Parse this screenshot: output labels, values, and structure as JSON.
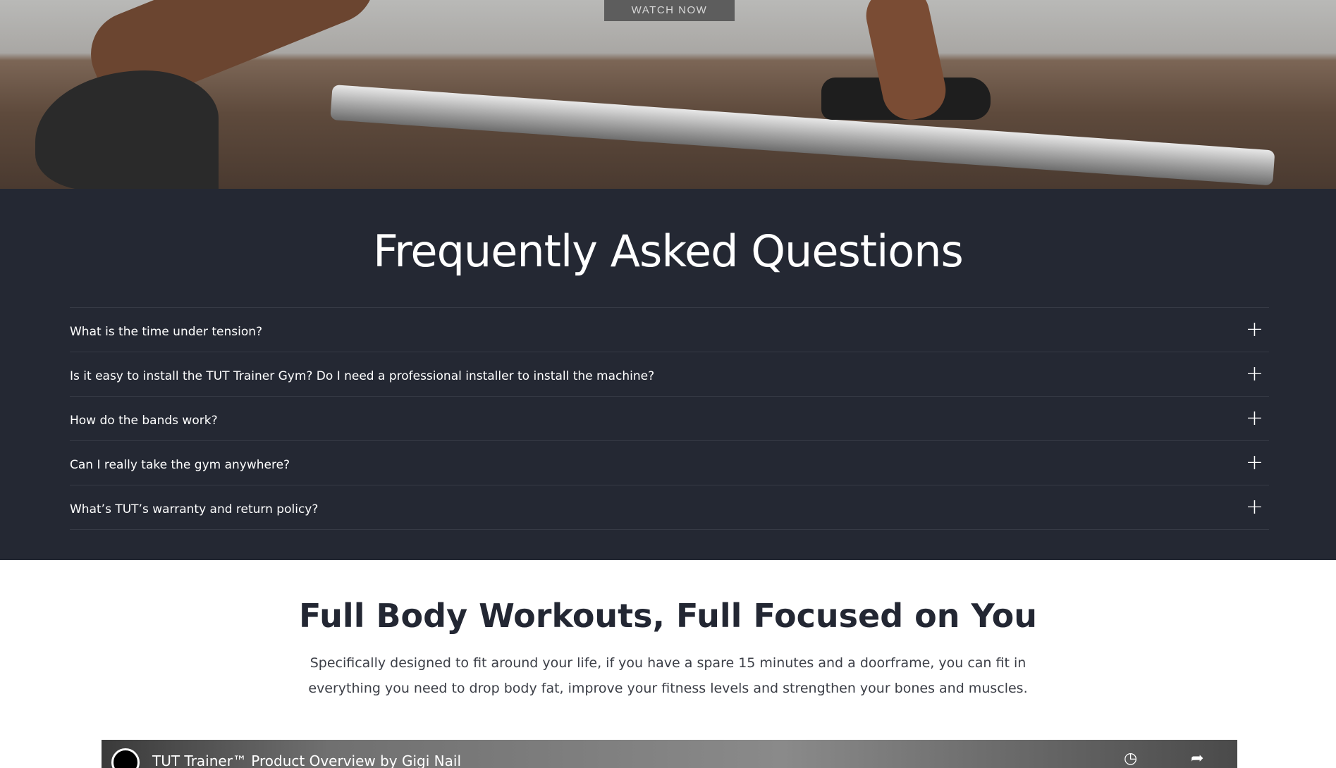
{
  "hero": {
    "watch_label": "WATCH NOW"
  },
  "faq": {
    "title": "Frequently Asked Questions",
    "items": [
      {
        "question": "What is the time under tension?",
        "icon": "plus-icon"
      },
      {
        "question": "Is it easy to install the TUT Trainer Gym? Do I need a professional installer to install the machine?",
        "icon": "plus-icon"
      },
      {
        "question": "How do the bands work?",
        "icon": "plus-icon"
      },
      {
        "question": "Can I really take the gym anywhere?",
        "icon": "plus-icon"
      },
      {
        "question": "What’s TUT’s warranty and return policy?",
        "icon": "plus-icon"
      }
    ]
  },
  "workouts": {
    "title": "Full Body Workouts, Full Focused on You",
    "description": "Specifically designed to fit around your life, if you have a spare 15 minutes and a doorframe, you can fit in everything you need to drop body fat, improve your fitness levels and strengthen your bones and muscles."
  },
  "video": {
    "title": "TUT Trainer™ Product Overview by Gigi Nail"
  },
  "colors": {
    "faq_bg": "#242833",
    "heading": "#232733"
  }
}
